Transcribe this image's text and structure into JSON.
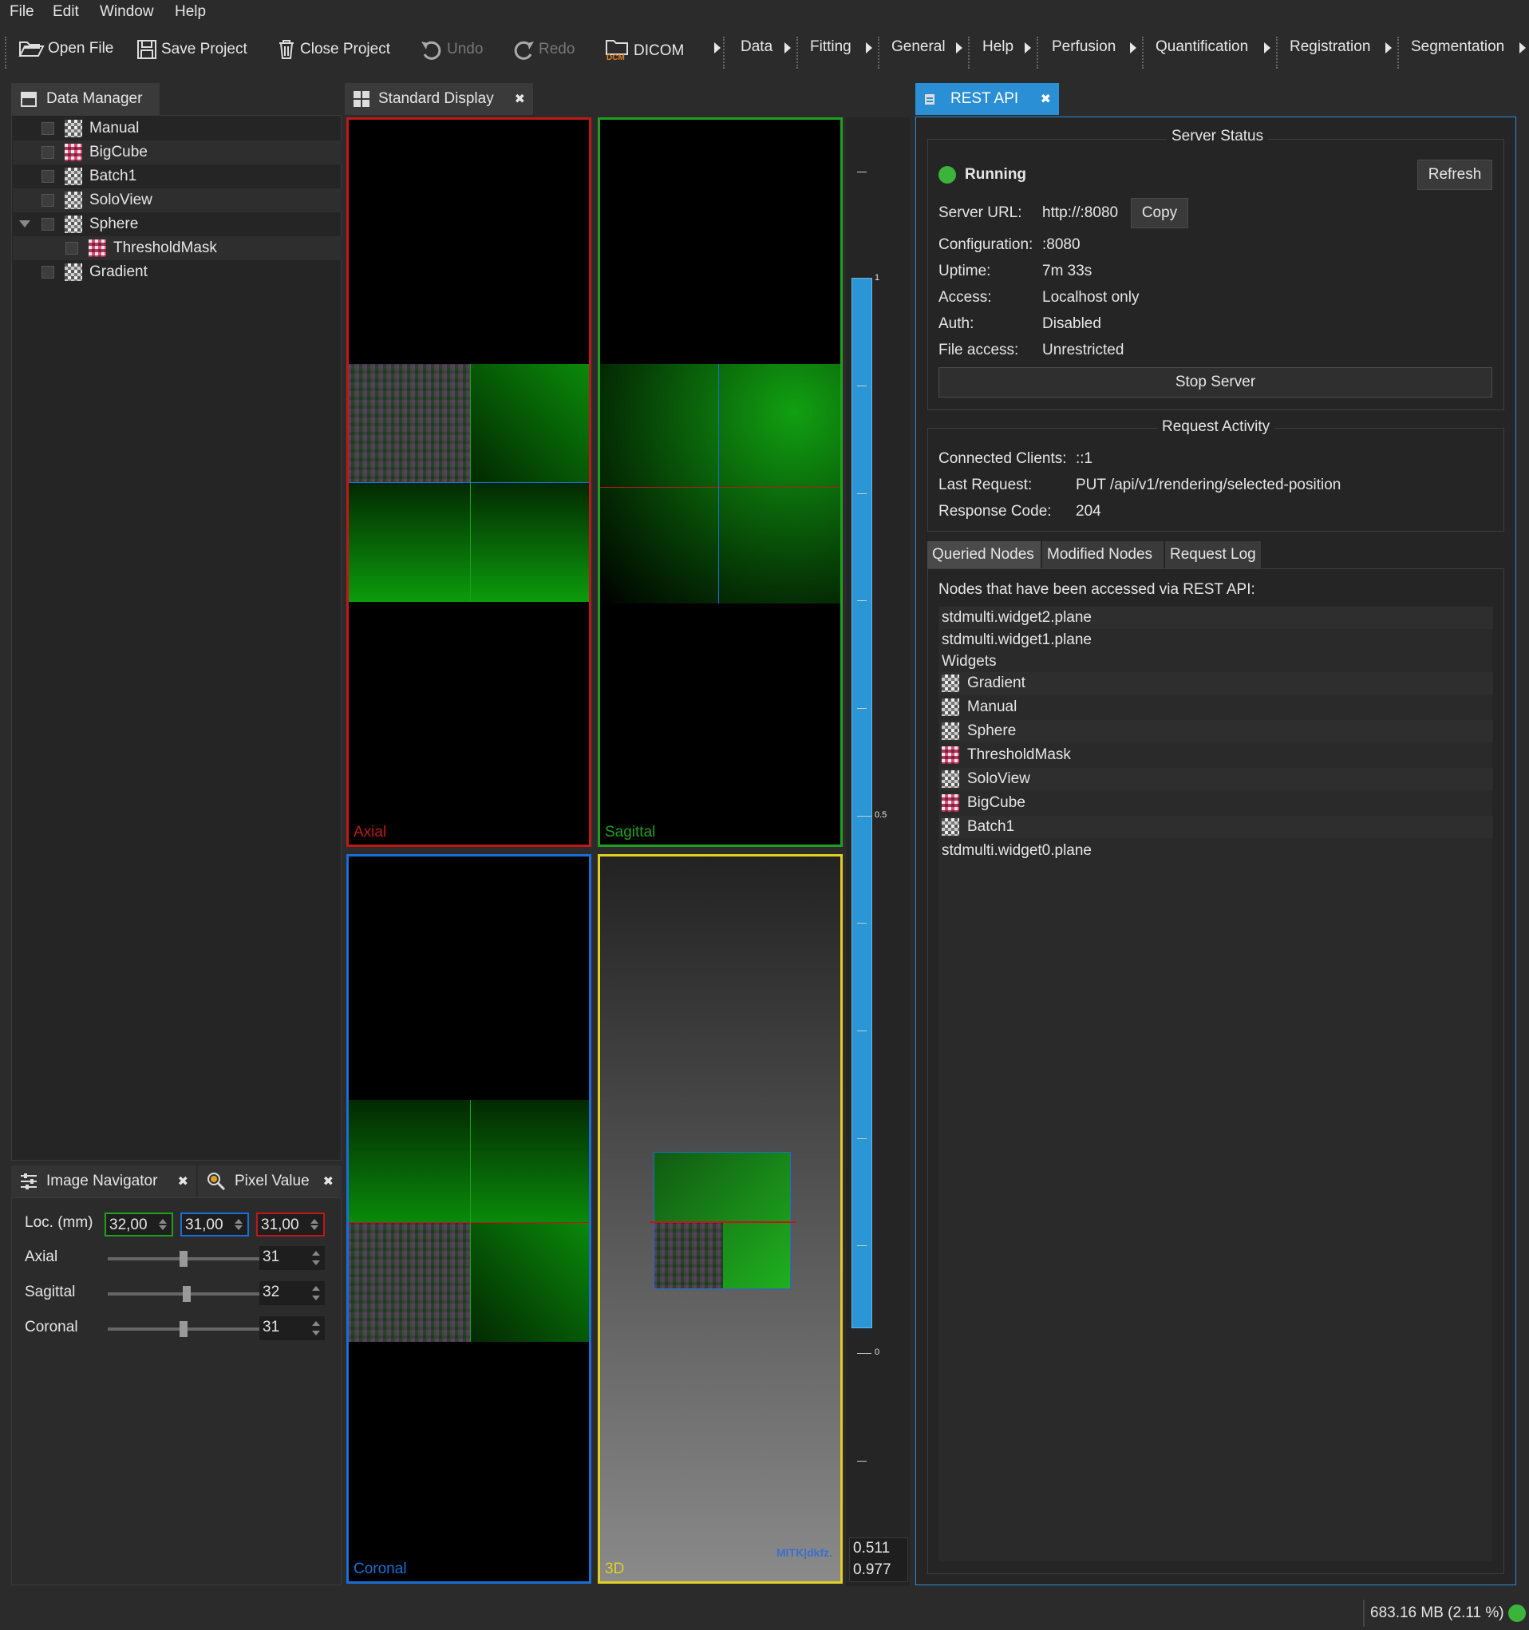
{
  "menu": [
    "File",
    "Edit",
    "Window",
    "Help"
  ],
  "toolbar": {
    "open_file": "Open File",
    "save_project": "Save Project",
    "close_project": "Close Project",
    "undo": "Undo",
    "redo": "Redo",
    "dicom": "DICOM",
    "dicom_icon_text": "DCM",
    "plugins": [
      "Data",
      "Fitting",
      "General",
      "Help",
      "Perfusion",
      "Quantification",
      "Registration",
      "Segmentation"
    ]
  },
  "data_manager": {
    "title": "Data Manager",
    "items": [
      {
        "label": "Manual",
        "icon": "grey"
      },
      {
        "label": "BigCube",
        "icon": "red"
      },
      {
        "label": "Batch1",
        "icon": "grey"
      },
      {
        "label": "SoloView",
        "icon": "grey"
      },
      {
        "label": "Sphere",
        "icon": "grey"
      },
      {
        "label": "ThresholdMask",
        "icon": "red"
      },
      {
        "label": "Gradient",
        "icon": "grey"
      }
    ]
  },
  "display": {
    "title": "Standard Display",
    "views": {
      "axial": "Axial",
      "sagittal": "Sagittal",
      "coronal": "Coronal",
      "three_d": "3D"
    },
    "logo": "MITK|dkfz.",
    "colorbar": {
      "top": "1",
      "mid": "0.5",
      "bottom": "0",
      "level": "0.511",
      "window": "0.977"
    }
  },
  "navigator": {
    "title": "Image Navigator",
    "pixel_value_title": "Pixel Value",
    "loc_label": "Loc. (mm)",
    "loc": [
      "32,00",
      "31,00",
      "31,00"
    ],
    "rows": [
      {
        "label": "Axial",
        "value": "31",
        "pos": 0.5
      },
      {
        "label": "Sagittal",
        "value": "32",
        "pos": 0.52
      },
      {
        "label": "Coronal",
        "value": "31",
        "pos": 0.5
      }
    ]
  },
  "rest": {
    "title": "REST API",
    "server_status": "Server Status",
    "status": "Running",
    "refresh": "Refresh",
    "fields": [
      {
        "k": "Server URL:",
        "v": "http://:8080"
      },
      {
        "k": "Configuration:",
        "v": ":8080"
      },
      {
        "k": "Uptime:",
        "v": "7m 33s"
      },
      {
        "k": "Access:",
        "v": "Localhost only"
      },
      {
        "k": "Auth:",
        "v": "Disabled"
      },
      {
        "k": "File access:",
        "v": "Unrestricted"
      }
    ],
    "copy": "Copy",
    "stop": "Stop Server",
    "activity_title": "Request Activity",
    "activity": [
      {
        "k": "Connected Clients:",
        "v": "::1"
      },
      {
        "k": "Last Request:",
        "v": "PUT /api/v1/rendering/selected-position"
      },
      {
        "k": "Response Code:",
        "v": "204"
      }
    ],
    "tabs": [
      "Queried Nodes",
      "Modified Nodes",
      "Request Log"
    ],
    "nodes_caption": "Nodes that have been accessed via REST API:",
    "nodes": [
      {
        "label": "stdmulti.widget2.plane",
        "icon": ""
      },
      {
        "label": "stdmulti.widget1.plane",
        "icon": ""
      },
      {
        "label": "Widgets",
        "icon": ""
      },
      {
        "label": "Gradient",
        "icon": "grey"
      },
      {
        "label": "Manual",
        "icon": "grey"
      },
      {
        "label": "Sphere",
        "icon": "grey"
      },
      {
        "label": "ThresholdMask",
        "icon": "red"
      },
      {
        "label": "SoloView",
        "icon": "grey"
      },
      {
        "label": "BigCube",
        "icon": "red"
      },
      {
        "label": "Batch1",
        "icon": "grey"
      },
      {
        "label": "stdmulti.widget0.plane",
        "icon": ""
      }
    ]
  },
  "status_bar": {
    "memory": "683.16 MB (2.11 %)"
  },
  "colors": {
    "accent": "#2b8fd6",
    "axial": "#c01818",
    "sagittal": "#1fa01f",
    "coronal": "#1a6fd6",
    "three_d": "#e0d020",
    "running": "#3cb43c"
  }
}
